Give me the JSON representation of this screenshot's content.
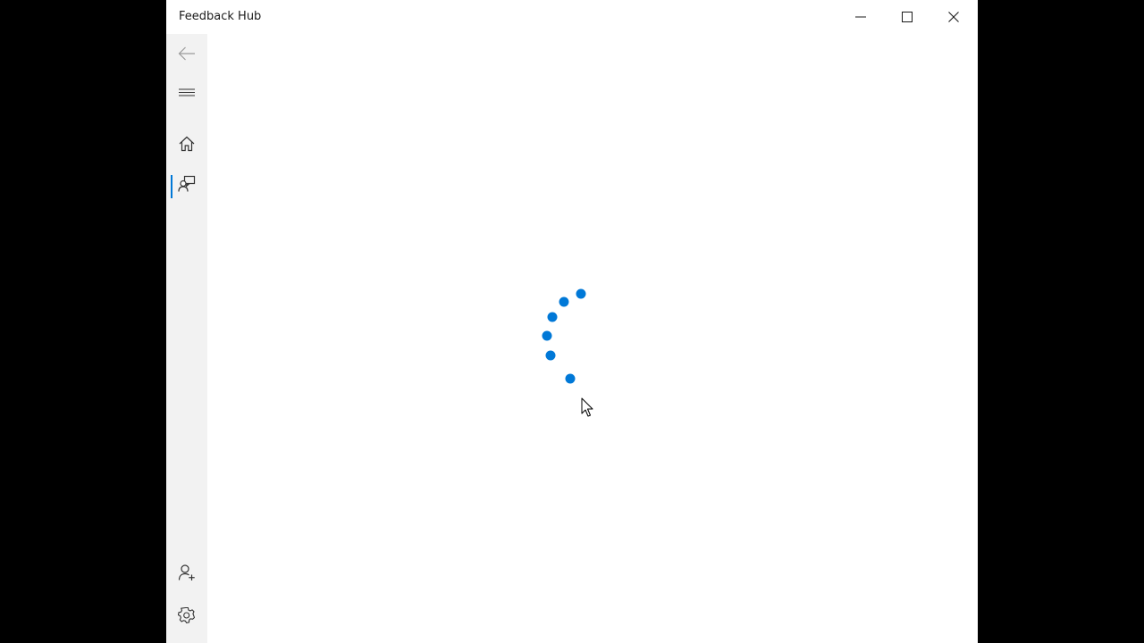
{
  "window": {
    "title": "Feedback Hub"
  },
  "caption_buttons": {
    "minimize_icon": "minimize-icon",
    "maximize_icon": "maximize-icon",
    "close_icon": "close-icon"
  },
  "nav": {
    "items": [
      {
        "id": "back",
        "icon": "back-arrow-icon",
        "selected": false
      },
      {
        "id": "menu",
        "icon": "hamburger-menu-icon",
        "selected": false
      },
      {
        "id": "home",
        "icon": "home-icon",
        "selected": false
      },
      {
        "id": "feedback",
        "icon": "feedback-icon",
        "selected": true
      },
      {
        "id": "account",
        "icon": "add-account-icon",
        "selected": false
      },
      {
        "id": "settings",
        "icon": "gear-icon",
        "selected": false
      }
    ]
  },
  "loading": {
    "indicator": "progress-ring-dots",
    "dot_count": 6
  },
  "colors": {
    "accent": "#0078d7",
    "nav_background": "#f2f2f2",
    "window_background": "#ffffff",
    "desktop_background": "#000000",
    "icon_color": "#333333"
  }
}
